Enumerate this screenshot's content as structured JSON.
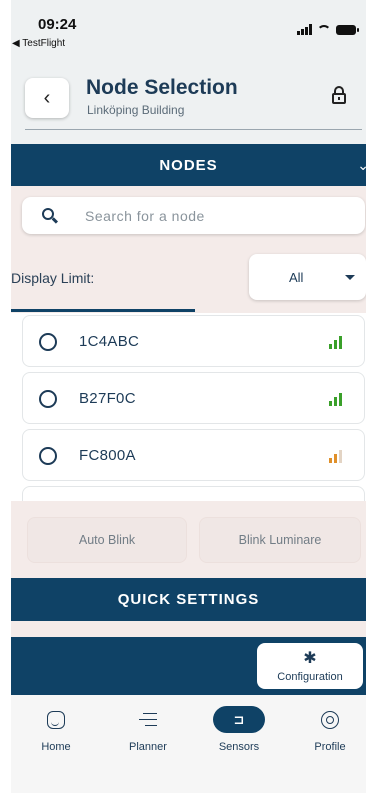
{
  "status_bar": {
    "time": "09:24",
    "back_app": "◀ TestFlight"
  },
  "header": {
    "title": "Node Selection",
    "subtitle": "Linköping Building"
  },
  "nodes_section": {
    "label": "NODES"
  },
  "search": {
    "placeholder": "Search for a node",
    "value": ""
  },
  "display_limit": {
    "label": "Display Limit:",
    "selected": "All"
  },
  "nodes": [
    {
      "id": "1C4ABC",
      "signal": "strong",
      "signal_color": "#3aa02a"
    },
    {
      "id": "B27F0C",
      "signal": "strong",
      "signal_color": "#3aa02a"
    },
    {
      "id": "FC800A",
      "signal": "medium",
      "signal_color": "#e0902a"
    }
  ],
  "blink": {
    "auto_label": "Auto Blink",
    "luminaire_label": "Blink Luminare"
  },
  "quick_settings": {
    "label": "QUICK SETTINGS"
  },
  "configuration": {
    "label": "Configuration",
    "icon": "gear-icon"
  },
  "bottom_nav": [
    {
      "label": "Home",
      "icon": "home-icon",
      "active": false
    },
    {
      "label": "Planner",
      "icon": "planner-icon",
      "active": false
    },
    {
      "label": "Sensors",
      "icon": "sensor-icon",
      "active": true
    },
    {
      "label": "Profile",
      "icon": "profile-icon",
      "active": false
    }
  ],
  "colors": {
    "primary": "#0f4266",
    "panel": "#f4ebe9",
    "text": "#1d3b57"
  }
}
